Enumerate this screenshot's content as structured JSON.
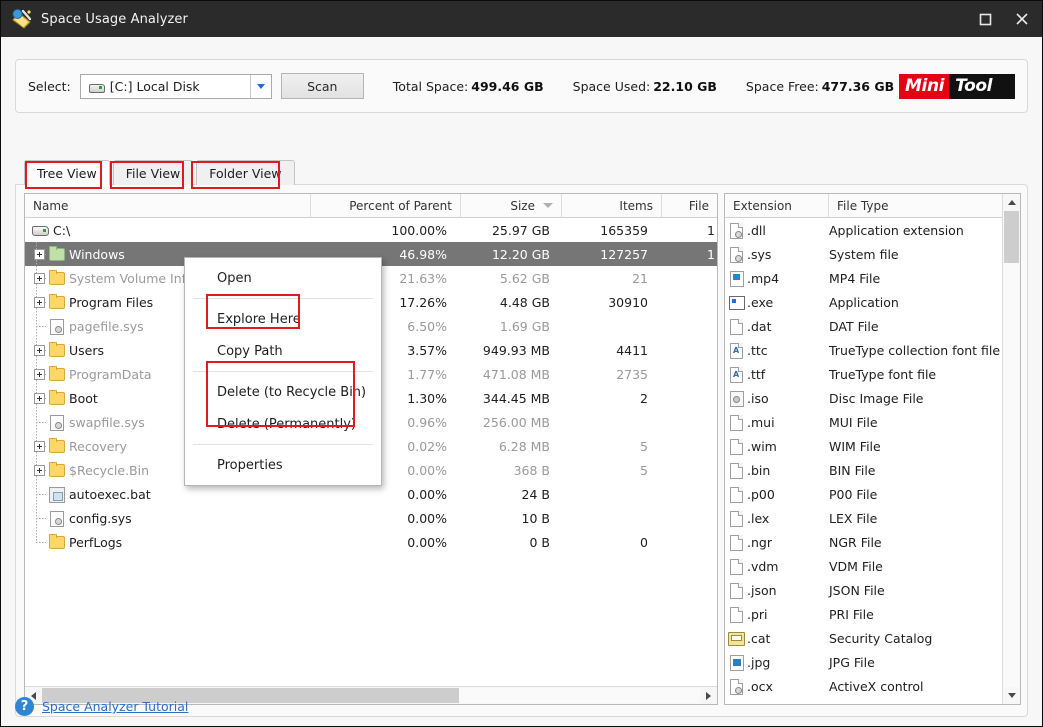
{
  "window": {
    "title": "Space Usage Analyzer",
    "app_icon": "space-analyzer-icon",
    "maximize_glyph": "☐",
    "close_glyph": "✕"
  },
  "toolbar": {
    "select_label": "Select:",
    "drive_value": "[C:] Local Disk",
    "drive_icon": "hard-drive-icon",
    "scan_label": "Scan",
    "total_space_label": "Total Space:",
    "total_space_value": "499.46 GB",
    "space_used_label": "Space Used:",
    "space_used_value": "22.10 GB",
    "space_free_label": "Space Free:",
    "space_free_value": "477.36 GB",
    "logo_part1": "Mini",
    "logo_part2": "Tool",
    "logo_color": "#e60012"
  },
  "tabs": [
    {
      "label": "Tree View",
      "active": true,
      "highlighted": true
    },
    {
      "label": "File View",
      "active": false,
      "highlighted": true
    },
    {
      "label": "Folder View",
      "active": false,
      "highlighted": true
    }
  ],
  "tree": {
    "columns": [
      "Name",
      "Percent of Parent",
      "Size",
      "Items",
      "File"
    ],
    "sorted_column": "Size",
    "sort_direction": "desc",
    "rows": [
      {
        "name": "C:\\",
        "icon": "drive-icon",
        "depth": 0,
        "expander": false,
        "dim": false,
        "selected": false,
        "percent": "100.00%",
        "size": "25.97 GB",
        "items": "165359",
        "files": "1"
      },
      {
        "name": "Windows",
        "icon": "folder-green",
        "depth": 1,
        "expander": true,
        "dim": false,
        "selected": true,
        "percent": "46.98%",
        "size": "12.20 GB",
        "items": "127257",
        "files": "1"
      },
      {
        "name": "System Volume Info",
        "icon": "folder",
        "depth": 1,
        "expander": true,
        "dim": true,
        "selected": false,
        "percent": "21.63%",
        "size": "5.62 GB",
        "items": "21",
        "files": ""
      },
      {
        "name": "Program Files",
        "icon": "folder",
        "depth": 1,
        "expander": true,
        "dim": false,
        "selected": false,
        "percent": "17.26%",
        "size": "4.48 GB",
        "items": "30910",
        "files": ""
      },
      {
        "name": "pagefile.sys",
        "icon": "system-file",
        "depth": 1,
        "expander": false,
        "dim": true,
        "selected": false,
        "percent": "6.50%",
        "size": "1.69 GB",
        "items": "",
        "files": ""
      },
      {
        "name": "Users",
        "icon": "folder",
        "depth": 1,
        "expander": true,
        "dim": false,
        "selected": false,
        "percent": "3.57%",
        "size": "949.93 MB",
        "items": "4411",
        "files": ""
      },
      {
        "name": "ProgramData",
        "icon": "folder",
        "depth": 1,
        "expander": true,
        "dim": true,
        "selected": false,
        "percent": "1.77%",
        "size": "471.08 MB",
        "items": "2735",
        "files": ""
      },
      {
        "name": "Boot",
        "icon": "folder",
        "depth": 1,
        "expander": true,
        "dim": false,
        "selected": false,
        "percent": "1.30%",
        "size": "344.45 MB",
        "items": "2",
        "files": ""
      },
      {
        "name": "swapfile.sys",
        "icon": "system-file",
        "depth": 1,
        "expander": false,
        "dim": true,
        "selected": false,
        "percent": "0.96%",
        "size": "256.00 MB",
        "items": "",
        "files": ""
      },
      {
        "name": "Recovery",
        "icon": "folder",
        "depth": 1,
        "expander": true,
        "dim": true,
        "selected": false,
        "percent": "0.02%",
        "size": "6.28 MB",
        "items": "5",
        "files": ""
      },
      {
        "name": "$Recycle.Bin",
        "icon": "folder",
        "depth": 1,
        "expander": true,
        "dim": true,
        "selected": false,
        "percent": "0.00%",
        "size": "368 B",
        "items": "5",
        "files": ""
      },
      {
        "name": "autoexec.bat",
        "icon": "bat-file",
        "depth": 1,
        "expander": false,
        "dim": false,
        "selected": false,
        "percent": "0.00%",
        "size": "24 B",
        "items": "",
        "files": ""
      },
      {
        "name": "config.sys",
        "icon": "system-file",
        "depth": 1,
        "expander": false,
        "dim": false,
        "selected": false,
        "percent": "0.00%",
        "size": "10 B",
        "items": "",
        "files": ""
      },
      {
        "name": "PerfLogs",
        "icon": "folder",
        "depth": 1,
        "expander": false,
        "dim": false,
        "selected": false,
        "percent": "0.00%",
        "size": "0 B",
        "items": "0",
        "files": ""
      }
    ]
  },
  "extensions": {
    "columns": [
      "Extension",
      "File Type"
    ],
    "rows": [
      {
        "ext": ".dll",
        "type": "Application extension",
        "icon": "system-file-icon"
      },
      {
        "ext": ".sys",
        "type": "System file",
        "icon": "system-file-icon"
      },
      {
        "ext": ".mp4",
        "type": "MP4 File",
        "icon": "video-file-icon"
      },
      {
        "ext": ".exe",
        "type": "Application",
        "icon": "application-icon"
      },
      {
        "ext": ".dat",
        "type": "DAT File",
        "icon": "blank-document-icon"
      },
      {
        "ext": ".ttc",
        "type": "TrueType collection font file",
        "icon": "font-file-icon"
      },
      {
        "ext": ".ttf",
        "type": "TrueType font file",
        "icon": "font-file-icon"
      },
      {
        "ext": ".iso",
        "type": "Disc Image File",
        "icon": "disc-image-icon"
      },
      {
        "ext": ".mui",
        "type": "MUI File",
        "icon": "blank-document-icon"
      },
      {
        "ext": ".wim",
        "type": "WIM File",
        "icon": "blank-document-icon"
      },
      {
        "ext": ".bin",
        "type": "BIN File",
        "icon": "blank-document-icon"
      },
      {
        "ext": ".p00",
        "type": "P00 File",
        "icon": "blank-document-icon"
      },
      {
        "ext": ".lex",
        "type": "LEX File",
        "icon": "blank-document-icon"
      },
      {
        "ext": ".ngr",
        "type": "NGR File",
        "icon": "blank-document-icon"
      },
      {
        "ext": ".vdm",
        "type": "VDM File",
        "icon": "blank-document-icon"
      },
      {
        "ext": ".json",
        "type": "JSON File",
        "icon": "blank-document-icon"
      },
      {
        "ext": ".pri",
        "type": "PRI File",
        "icon": "blank-document-icon"
      },
      {
        "ext": ".cat",
        "type": "Security Catalog",
        "icon": "security-catalog-icon"
      },
      {
        "ext": ".jpg",
        "type": "JPG File",
        "icon": "image-file-icon"
      },
      {
        "ext": ".ocx",
        "type": "ActiveX control",
        "icon": "system-file-icon"
      }
    ]
  },
  "context_menu": {
    "items": [
      {
        "label": "Open",
        "highlighted": false,
        "separator_after": true
      },
      {
        "label": "Explore Here",
        "highlighted": true,
        "separator_after": false
      },
      {
        "label": "Copy Path",
        "highlighted": false,
        "separator_after": true
      },
      {
        "label": "Delete (to Recycle Bin)",
        "highlighted": true,
        "separator_after": false
      },
      {
        "label": "Delete (Permanently)",
        "highlighted": true,
        "separator_after": true
      },
      {
        "label": "Properties",
        "highlighted": false,
        "separator_after": false
      }
    ]
  },
  "footer": {
    "help_glyph": "?",
    "tutorial_link": "Space Analyzer Tutorial"
  }
}
